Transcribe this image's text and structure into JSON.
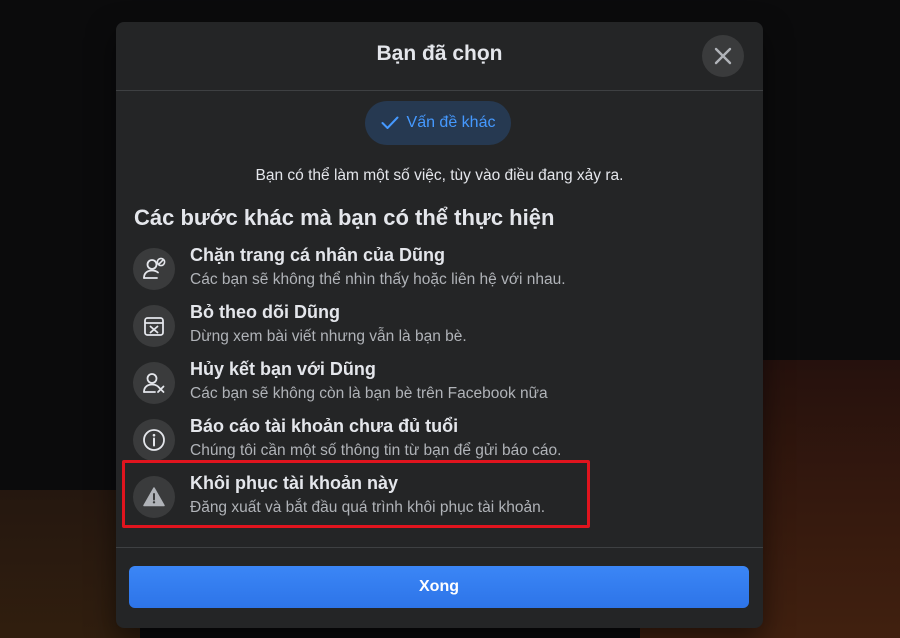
{
  "modal": {
    "title": "Bạn đã chọn",
    "close_icon": "close-icon",
    "selected_chip": {
      "icon": "check-icon",
      "label": "Vấn đề khác"
    },
    "subtitle": "Bạn có thể làm một số việc, tùy vào điều đang xảy ra.",
    "section_heading": "Các bước khác mà bạn có thể thực hiện",
    "options": [
      {
        "icon": "block-profile-icon",
        "title": "Chặn trang cá nhân của Dũng",
        "description": "Các bạn sẽ không thể nhìn thấy hoặc liên hệ với nhau."
      },
      {
        "icon": "unfollow-icon",
        "title": "Bỏ theo dõi Dũng",
        "description": "Dừng xem bài viết nhưng vẫn là bạn bè."
      },
      {
        "icon": "unfriend-icon",
        "title": "Hủy kết bạn với Dũng",
        "description": "Các bạn sẽ không còn là bạn bè trên Facebook nữa"
      },
      {
        "icon": "info-icon",
        "title": "Báo cáo tài khoản chưa đủ tuổi",
        "description": "Chúng tôi cần một số thông tin từ bạn để gửi báo cáo."
      },
      {
        "icon": "warning-icon",
        "title": "Khôi phục tài khoản này",
        "description": "Đăng xuất và bắt đầu quá trình khôi phục tài khoản."
      }
    ],
    "done_button": "Xong"
  },
  "colors": {
    "modal_bg": "#242526",
    "accent_blue": "#2d88ff",
    "done_button": "#2d7ff9",
    "highlight_red": "#e0141e",
    "icon_circle": "#3a3b3c"
  }
}
